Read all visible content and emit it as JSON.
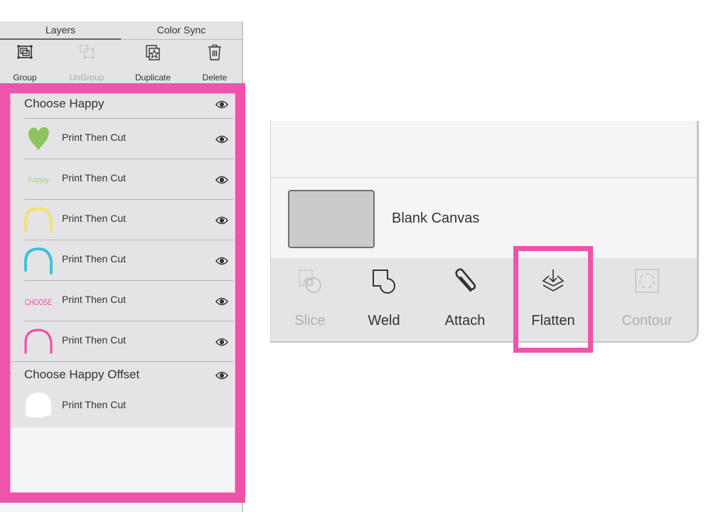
{
  "layers_panel": {
    "tabs": [
      {
        "label": "Layers",
        "active": true
      },
      {
        "label": "Color Sync",
        "active": false
      }
    ],
    "tools": [
      {
        "label": "Group",
        "icon": "group-icon",
        "enabled": true
      },
      {
        "label": "UnGroup",
        "icon": "ungroup-icon",
        "enabled": false
      },
      {
        "label": "Duplicate",
        "icon": "duplicate-icon",
        "enabled": true
      },
      {
        "label": "Delete",
        "icon": "trash-icon",
        "enabled": true
      }
    ],
    "groups": [
      {
        "name": "Choose Happy",
        "visible": true,
        "layers": [
          {
            "type": "Print Then Cut",
            "thumb": "green-heart",
            "visible": true
          },
          {
            "type": "Print Then Cut",
            "thumb": "happy-script",
            "thumb_text": "happy",
            "visible": true
          },
          {
            "type": "Print Then Cut",
            "thumb": "yellow-arch",
            "visible": true
          },
          {
            "type": "Print Then Cut",
            "thumb": "blue-arch",
            "visible": true
          },
          {
            "type": "Print Then Cut",
            "thumb": "choose-text",
            "thumb_text": "CHOOSE",
            "visible": true
          },
          {
            "type": "Print Then Cut",
            "thumb": "pink-arch",
            "visible": true
          }
        ]
      },
      {
        "name": "Choose Happy Offset",
        "visible": true,
        "layers": [
          {
            "type": "Print Then Cut",
            "thumb": "white-offset-shape",
            "visible": false
          }
        ]
      }
    ]
  },
  "operations_panel": {
    "canvas_label": "Blank Canvas",
    "operations": [
      {
        "label": "Slice",
        "icon": "slice-icon",
        "enabled": false
      },
      {
        "label": "Weld",
        "icon": "weld-icon",
        "enabled": true
      },
      {
        "label": "Attach",
        "icon": "paperclip-icon",
        "enabled": true
      },
      {
        "label": "Flatten",
        "icon": "flatten-icon",
        "enabled": true,
        "highlighted": true
      },
      {
        "label": "Contour",
        "icon": "contour-icon",
        "enabled": false
      }
    ]
  },
  "colors": {
    "highlight": "#ee54ac",
    "heart": "#8cc45e",
    "yellow": "#f5e15f",
    "blue": "#3dc2dc",
    "pink": "#ef4aa6"
  }
}
